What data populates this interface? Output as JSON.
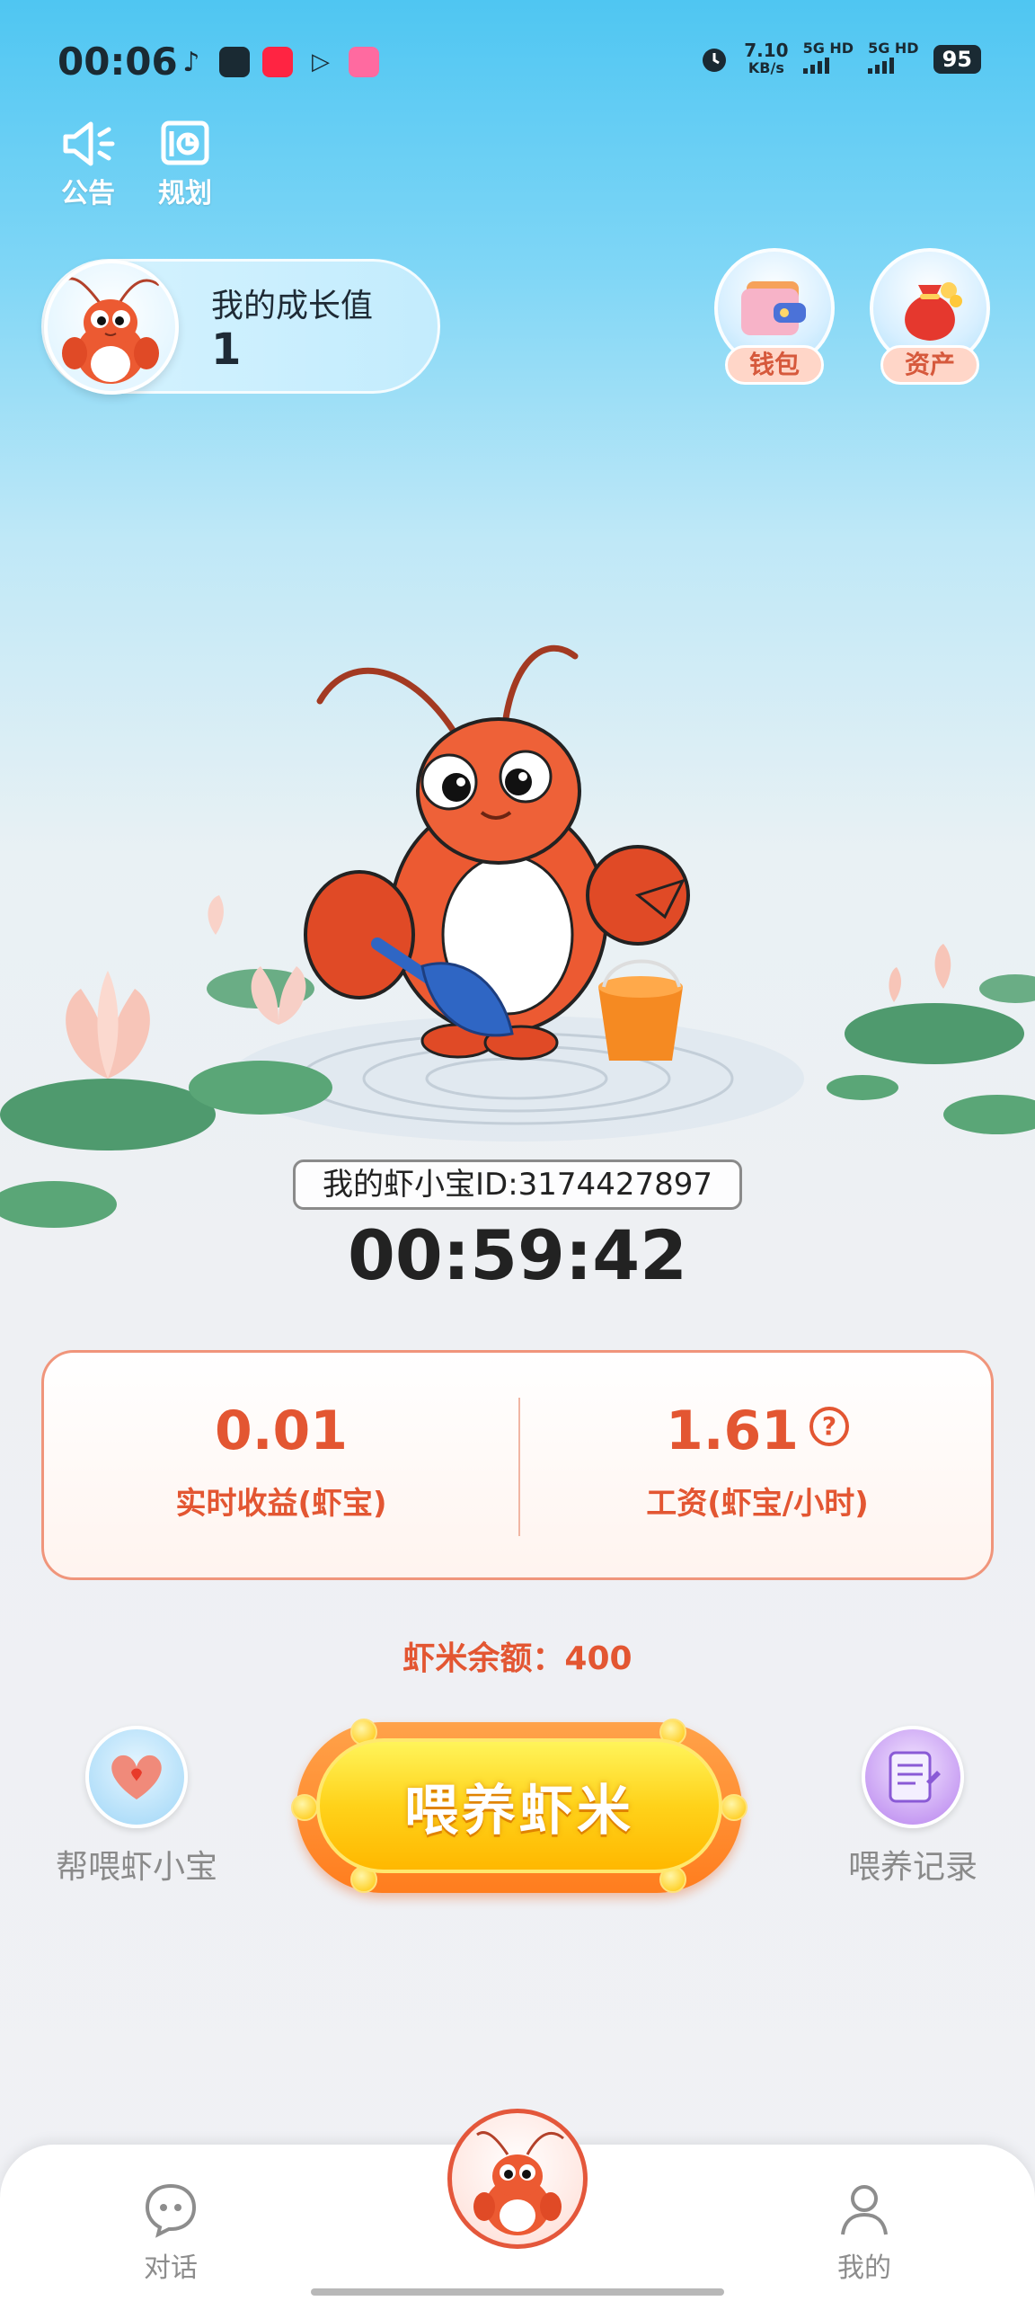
{
  "status_bar": {
    "time": "00:06",
    "net_speed_value": "7.10",
    "net_speed_unit": "KB/s",
    "network_1": "5G HD",
    "network_2": "5G HD",
    "battery": "95"
  },
  "toolbar": {
    "announcement_label": "公告",
    "plan_label": "规划"
  },
  "growth": {
    "title": "我的成长值",
    "value": "1"
  },
  "top_buttons": {
    "wallet_label": "钱包",
    "assets_label": "资产"
  },
  "shrimp": {
    "id_text": "我的虾小宝ID:3174427897",
    "countdown": "00:59:42"
  },
  "earnings": {
    "realtime_value": "0.01",
    "realtime_label": "实时收益(虾宝)",
    "wage_value": "1.61",
    "wage_label": "工资(虾宝/小时)",
    "help_symbol": "?"
  },
  "balance_text": "虾米余额：400",
  "actions": {
    "help_feed_label": "帮喂虾小宝",
    "feed_button_label": "喂养虾米",
    "feed_record_label": "喂养记录"
  },
  "bottom_nav": {
    "chat_label": "对话",
    "mine_label": "我的"
  },
  "colors": {
    "accent": "#e35632",
    "sky_top": "#4fc6f2",
    "feed_button": "#ffd21a"
  }
}
